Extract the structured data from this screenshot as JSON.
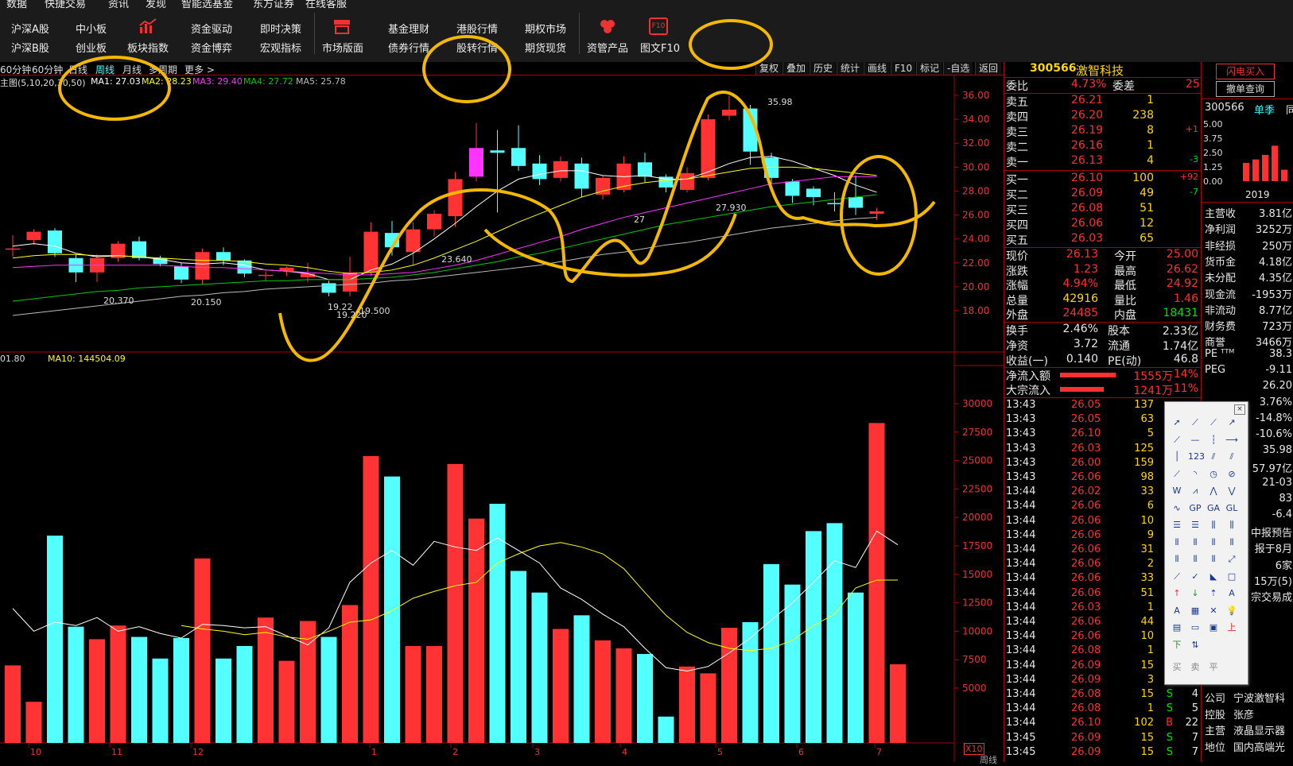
{
  "menu": {
    "top_cut": [
      "数据",
      "快捷交易",
      "资讯",
      "发现",
      "智能选基金",
      "东方证券",
      "在线客服"
    ],
    "row1": [
      "沪深A股",
      "中小板",
      "板块指数",
      "资金驱动",
      "即时决策",
      "市场版面",
      "基金理财",
      "港股行情",
      "期权市场",
      "资管产品",
      "图文F10"
    ],
    "row2": [
      "沪深B股",
      "创业板",
      "资金博弈",
      "宏观指标",
      "债券行情",
      "股转行情",
      "期货现货"
    ],
    "f10_icon_text": "F10"
  },
  "periods": [
    "60分钟",
    "60分钟",
    "日线",
    "周线",
    "月线",
    "多周期",
    "更多 >"
  ],
  "period_active": "周线",
  "chart_tools": [
    "复权",
    "叠加",
    "历史",
    "统计",
    "画线",
    "F10",
    "标记",
    "-自选",
    "返回"
  ],
  "ma_legend": {
    "main": "主图(5,10,20,30,50)",
    "ma1": "MA1: 27.03",
    "ma2": "MA2: 28.23",
    "ma3": "MA3: 29.40",
    "ma4": "MA4: 27.72",
    "ma5": "MA5: 25.78"
  },
  "vol_legend": {
    "vol": "01.80",
    "ma10": "MA10: 144504.09"
  },
  "annotations": {
    "high": "35.98",
    "low1": "19.22",
    "low2": "19.220",
    "low3": "19.500",
    "p1": "20.370",
    "p2": "20.150",
    "p3": "23.640",
    "p4": "27.930",
    "p5": "27",
    "x10": "X10",
    "week": "周线"
  },
  "colors": {
    "up": "#ff3333",
    "down": "#54ffff",
    "ma1": "#ffffff",
    "ma2": "#ffff00",
    "ma3": "#ff33ff",
    "ma4": "#00cc00",
    "ma5": "#bbbbbb",
    "annotation": "#f5b800"
  },
  "chart_data": {
    "type": "candlestick",
    "price_axis": {
      "ticks": [
        "36.00",
        "34.00",
        "32.00",
        "30.00",
        "28.00",
        "26.00",
        "24.00",
        "22.00",
        "20.00",
        "18.00"
      ],
      "ylim": [
        17,
        37.2
      ]
    },
    "volume_axis": {
      "ticks": [
        "30000",
        "27500",
        "25000",
        "22500",
        "20000",
        "17500",
        "15000",
        "12500",
        "10000",
        "7500",
        "5000"
      ],
      "ylim": [
        0,
        31400
      ]
    },
    "x_ticks": [
      "10",
      "11",
      "12",
      "1",
      "2",
      "3",
      "4",
      "5",
      "6",
      "7"
    ],
    "candles": [
      {
        "o": 23.2,
        "c": 23.2,
        "h": 24.3,
        "l": 22.5,
        "up": true
      },
      {
        "o": 24.6,
        "c": 23.9,
        "h": 24.8,
        "l": 23.5,
        "up": true
      },
      {
        "o": 24.7,
        "c": 22.8,
        "h": 24.9,
        "l": 22.5,
        "up": false
      },
      {
        "o": 22.4,
        "c": 21.2,
        "h": 22.7,
        "l": 20.4,
        "up": false
      },
      {
        "o": 21.2,
        "c": 22.4,
        "h": 22.7,
        "l": 20.4,
        "up": true
      },
      {
        "o": 22.4,
        "c": 23.6,
        "h": 23.8,
        "l": 22.1,
        "up": true
      },
      {
        "o": 23.8,
        "c": 22.4,
        "h": 24.2,
        "l": 22.2,
        "up": false
      },
      {
        "o": 22.4,
        "c": 21.9,
        "h": 22.6,
        "l": 21.7,
        "up": false
      },
      {
        "o": 21.7,
        "c": 20.6,
        "h": 22.0,
        "l": 20.3,
        "up": false
      },
      {
        "o": 20.6,
        "c": 22.9,
        "h": 23.2,
        "l": 20.2,
        "up": true
      },
      {
        "o": 22.9,
        "c": 22.2,
        "h": 23.3,
        "l": 21.8,
        "up": false
      },
      {
        "o": 22.2,
        "c": 21.1,
        "h": 22.3,
        "l": 20.8,
        "up": false
      },
      {
        "o": 21.0,
        "c": 20.9,
        "h": 21.3,
        "l": 20.5,
        "up": true
      },
      {
        "o": 21.3,
        "c": 21.6,
        "h": 21.7,
        "l": 20.9,
        "up": true
      },
      {
        "o": 21.1,
        "c": 20.8,
        "h": 22.0,
        "l": 20.4,
        "up": true
      },
      {
        "o": 20.3,
        "c": 19.5,
        "h": 20.5,
        "l": 19.2,
        "up": false
      },
      {
        "o": 19.6,
        "c": 21.2,
        "h": 22.5,
        "l": 19.2,
        "up": true
      },
      {
        "o": 21.2,
        "c": 24.6,
        "h": 25.4,
        "l": 20.9,
        "up": true
      },
      {
        "o": 24.5,
        "c": 23.3,
        "h": 25.5,
        "l": 22.6,
        "up": false
      },
      {
        "o": 22.9,
        "c": 24.8,
        "h": 25.4,
        "l": 21.8,
        "up": true
      },
      {
        "o": 24.8,
        "c": 26.1,
        "h": 26.4,
        "l": 24.2,
        "up": true
      },
      {
        "o": 25.9,
        "c": 29.0,
        "h": 29.6,
        "l": 25.0,
        "up": true
      },
      {
        "o": 29.2,
        "c": 31.6,
        "h": 33.7,
        "l": 28.8,
        "up": true
      },
      {
        "o": 31.4,
        "c": 31.2,
        "h": 33.1,
        "l": 26.2,
        "up": false
      },
      {
        "o": 31.6,
        "c": 30.1,
        "h": 33.5,
        "l": 29.7,
        "up": false
      },
      {
        "o": 30.3,
        "c": 29.0,
        "h": 31.0,
        "l": 28.5,
        "up": false
      },
      {
        "o": 29.1,
        "c": 30.5,
        "h": 30.9,
        "l": 28.8,
        "up": true
      },
      {
        "o": 30.3,
        "c": 28.2,
        "h": 30.8,
        "l": 27.5,
        "up": false
      },
      {
        "o": 29.1,
        "c": 27.7,
        "h": 29.3,
        "l": 27.3,
        "up": true
      },
      {
        "o": 28.1,
        "c": 30.3,
        "h": 30.9,
        "l": 27.9,
        "up": true
      },
      {
        "o": 30.4,
        "c": 29.2,
        "h": 31.2,
        "l": 28.7,
        "up": false
      },
      {
        "o": 29.2,
        "c": 28.3,
        "h": 29.4,
        "l": 27.9,
        "up": false
      },
      {
        "o": 28.1,
        "c": 29.5,
        "h": 30.0,
        "l": 27.9,
        "up": true
      },
      {
        "o": 29.1,
        "c": 34.0,
        "h": 34.4,
        "l": 28.9,
        "up": true
      },
      {
        "o": 34.3,
        "c": 34.8,
        "h": 35.98,
        "l": 33.9,
        "up": true
      },
      {
        "o": 34.9,
        "c": 31.3,
        "h": 35.2,
        "l": 30.2,
        "up": false
      },
      {
        "o": 30.8,
        "c": 29.1,
        "h": 31.2,
        "l": 28.6,
        "up": false
      },
      {
        "o": 28.8,
        "c": 27.6,
        "h": 29.0,
        "l": 27.0,
        "up": false
      },
      {
        "o": 28.2,
        "c": 27.5,
        "h": 28.4,
        "l": 26.8,
        "up": false
      },
      {
        "o": 27.0,
        "c": 26.9,
        "h": 27.9,
        "l": 26.3,
        "up": false
      },
      {
        "o": 27.5,
        "c": 26.6,
        "h": 29.3,
        "l": 26.0,
        "up": false
      },
      {
        "o": 26.3,
        "c": 26.1,
        "h": 26.6,
        "l": 25.6,
        "up": true
      }
    ],
    "ma_series": {
      "ma1": [
        23.4,
        23.6,
        23.4,
        22.8,
        22.5,
        22.6,
        22.5,
        22.3,
        22.0,
        21.9,
        22.0,
        21.8,
        21.4,
        21.3,
        21.1,
        20.6,
        20.6,
        21.4,
        21.9,
        22.8,
        24.0,
        25.3,
        26.7,
        28.0,
        29.0,
        29.4,
        29.7,
        29.7,
        29.3,
        29.2,
        29.3,
        29.0,
        29.0,
        29.6,
        30.3,
        30.8,
        30.9,
        30.5,
        29.9,
        29.3,
        28.5,
        27.9
      ],
      "ma2": [
        22.4,
        22.6,
        22.7,
        22.7,
        22.6,
        22.6,
        22.5,
        22.4,
        22.3,
        22.2,
        22.2,
        22.1,
        21.9,
        21.8,
        21.6,
        21.3,
        21.1,
        21.2,
        21.4,
        21.8,
        22.4,
        23.1,
        23.8,
        24.6,
        25.4,
        26.1,
        26.8,
        27.5,
        28.0,
        28.4,
        28.7,
        28.9,
        29.0,
        29.3,
        29.6,
        29.9,
        30.0,
        30.0,
        29.9,
        29.7,
        29.5,
        29.3
      ],
      "ma3": [
        21.6,
        21.7,
        21.8,
        21.8,
        21.8,
        21.8,
        21.8,
        21.8,
        21.7,
        21.6,
        21.6,
        21.5,
        21.4,
        21.3,
        21.2,
        21.1,
        21.0,
        21.0,
        21.1,
        21.2,
        21.5,
        21.8,
        22.2,
        22.7,
        23.2,
        23.7,
        24.2,
        24.8,
        25.3,
        25.8,
        26.2,
        26.6,
        27.0,
        27.4,
        27.8,
        28.2,
        28.6,
        28.8,
        29.0,
        29.2,
        29.2,
        29.2
      ],
      "ma4": [
        18.8,
        19.0,
        19.2,
        19.4,
        19.6,
        19.7,
        19.9,
        20.0,
        20.1,
        20.2,
        20.3,
        20.4,
        20.5,
        20.5,
        20.6,
        20.6,
        20.6,
        20.7,
        20.8,
        21.0,
        21.2,
        21.5,
        21.8,
        22.1,
        22.5,
        22.8,
        23.2,
        23.6,
        24.0,
        24.4,
        24.8,
        25.2,
        25.5,
        25.8,
        26.1,
        26.4,
        26.7,
        26.9,
        27.1,
        27.3,
        27.5,
        27.7
      ],
      "ma5": [
        17.6,
        17.8,
        18.0,
        18.2,
        18.4,
        18.6,
        18.8,
        19.0,
        19.2,
        19.3,
        19.5,
        19.6,
        19.8,
        19.9,
        20.0,
        20.1,
        20.2,
        20.3,
        20.5,
        20.6,
        20.8,
        21.0,
        21.2,
        21.4,
        21.6,
        21.8,
        22.1,
        22.4,
        22.7,
        22.9,
        23.2,
        23.5,
        23.7,
        24.0,
        24.3,
        24.6,
        24.9,
        25.1,
        25.3,
        25.5,
        25.7,
        25.8
      ]
    },
    "volume": [
      7000,
      3800,
      18400,
      10400,
      9300,
      10500,
      9500,
      7600,
      9400,
      16400,
      7600,
      8700,
      11200,
      7400,
      10900,
      9500,
      12300,
      25400,
      23600,
      8700,
      8700,
      24700,
      19900,
      21200,
      15300,
      13400,
      10200,
      11400,
      9200,
      8500,
      8000,
      2500,
      6900,
      6300,
      10300,
      10800,
      15900,
      14100,
      18800,
      19500,
      13400,
      28300,
      7100
    ],
    "vol_ma5": [
      12000,
      10000,
      10800,
      10500,
      11200,
      10000,
      10400,
      9800,
      9400,
      10600,
      10500,
      10300,
      10400,
      9600,
      8800,
      10300,
      14300,
      16000,
      17100,
      15800,
      17900,
      17400,
      17100,
      18200,
      17100,
      16000,
      13800,
      12800,
      11500,
      10400,
      8500,
      6800,
      6500,
      6900,
      8100,
      9400,
      11000,
      12500,
      14300,
      16200,
      15600,
      18800,
      17600
    ],
    "vol_ma10": [
      null,
      null,
      null,
      null,
      null,
      null,
      null,
      null,
      10500,
      10200,
      10000,
      9700,
      9900,
      9500,
      9300,
      10000,
      10800,
      11000,
      11800,
      12900,
      13500,
      14000,
      14300,
      16000,
      16800,
      17500,
      17800,
      17400,
      16800,
      15500,
      13400,
      11400,
      9900,
      9000,
      8500,
      8300,
      8500,
      9200,
      10500,
      11500,
      13800,
      14500,
      14500
    ]
  },
  "quote": {
    "code": "300566",
    "name": "激智科技",
    "weibi_label": "委比",
    "weibi": "4.73%",
    "weicha_label": "委差",
    "weicha": "25",
    "asks": [
      {
        "label": "卖五",
        "price": "26.21",
        "vol": "1",
        "chg": ""
      },
      {
        "label": "卖四",
        "price": "26.20",
        "vol": "238",
        "chg": ""
      },
      {
        "label": "卖三",
        "price": "26.19",
        "vol": "8",
        "chg": "+1"
      },
      {
        "label": "卖二",
        "price": "26.16",
        "vol": "1",
        "chg": ""
      },
      {
        "label": "卖一",
        "price": "26.13",
        "vol": "4",
        "chg": "-3"
      }
    ],
    "bids": [
      {
        "label": "买一",
        "price": "26.10",
        "vol": "100",
        "chg": "+92"
      },
      {
        "label": "买二",
        "price": "26.09",
        "vol": "49",
        "chg": "-7"
      },
      {
        "label": "买三",
        "price": "26.08",
        "vol": "51",
        "chg": ""
      },
      {
        "label": "买四",
        "price": "26.06",
        "vol": "12",
        "chg": ""
      },
      {
        "label": "买五",
        "price": "26.03",
        "vol": "65",
        "chg": ""
      }
    ],
    "stats": [
      {
        "l1": "现价",
        "v1": "26.13",
        "c1": "red",
        "l2": "今开",
        "v2": "25.00",
        "c2": "red"
      },
      {
        "l1": "涨跌",
        "v1": "1.23",
        "c1": "red",
        "l2": "最高",
        "v2": "26.62",
        "c2": "red"
      },
      {
        "l1": "涨幅",
        "v1": "4.94%",
        "c1": "red",
        "l2": "最低",
        "v2": "24.92",
        "c2": "red"
      },
      {
        "l1": "总量",
        "v1": "42916",
        "c1": "yellow",
        "l2": "量比",
        "v2": "1.46",
        "c2": "red"
      },
      {
        "l1": "外盘",
        "v1": "24485",
        "c1": "red",
        "l2": "内盘",
        "v2": "18431",
        "c2": "green"
      }
    ],
    "stats2": [
      {
        "l1": "换手",
        "v1": "2.46%",
        "l2": "股本",
        "v2": "2.33亿"
      },
      {
        "l1": "净资",
        "v1": "3.72",
        "l2": "流通",
        "v2": "1.74亿"
      },
      {
        "l1": "收益(一)",
        "v1": "0.140",
        "l2": "PE(动)",
        "v2": "46.8"
      }
    ],
    "flows": [
      {
        "label": "净流入额",
        "value": "1555万",
        "pct": "14%"
      },
      {
        "label": "大宗流入",
        "value": "1241万",
        "pct": "11%"
      }
    ],
    "ticks": [
      [
        "13:43",
        "26.05",
        "137",
        "",
        ""
      ],
      [
        "13:43",
        "26.05",
        "63",
        "",
        ""
      ],
      [
        "13:43",
        "26.10",
        "5",
        "",
        ""
      ],
      [
        "13:43",
        "26.03",
        "125",
        "",
        ""
      ],
      [
        "13:43",
        "26.00",
        "159",
        "",
        ""
      ],
      [
        "13:43",
        "26.06",
        "98",
        "",
        ""
      ],
      [
        "13:44",
        "26.02",
        "33",
        "",
        ""
      ],
      [
        "13:44",
        "26.06",
        "6",
        "",
        ""
      ],
      [
        "13:44",
        "26.06",
        "10",
        "",
        ""
      ],
      [
        "13:44",
        "26.06",
        "9",
        "",
        ""
      ],
      [
        "13:44",
        "26.06",
        "31",
        "",
        ""
      ],
      [
        "13:44",
        "26.06",
        "2",
        "",
        ""
      ],
      [
        "13:44",
        "26.06",
        "33",
        "",
        ""
      ],
      [
        "13:44",
        "26.06",
        "51",
        "",
        ""
      ],
      [
        "13:44",
        "26.03",
        "1",
        "",
        ""
      ],
      [
        "13:44",
        "26.06",
        "44",
        "",
        ""
      ],
      [
        "13:44",
        "26.06",
        "10",
        "",
        ""
      ],
      [
        "13:44",
        "26.08",
        "1",
        "",
        ""
      ],
      [
        "13:44",
        "26.09",
        "15",
        "",
        ""
      ],
      [
        "13:44",
        "26.09",
        "3",
        "B",
        ""
      ],
      [
        "13:44",
        "26.08",
        "15",
        "S",
        "4"
      ],
      [
        "13:44",
        "26.08",
        "1",
        "S",
        "5"
      ],
      [
        "13:44",
        "26.10",
        "102",
        "B",
        "22"
      ],
      [
        "13:45",
        "26.09",
        "15",
        "S",
        "7"
      ],
      [
        "13:45",
        "26.09",
        "15",
        "S",
        "7"
      ]
    ]
  },
  "right": {
    "flash_buy": "闪电买入",
    "cancel_query": "撤单查询",
    "code": "300566",
    "season": "单季",
    "same": "同",
    "bar_ticks": [
      "5.00",
      "3.75",
      "2.50",
      "1.25",
      "0.00"
    ],
    "bar_year": "2019",
    "bar_values": [
      1.6,
      1.9,
      2.3,
      3.1,
      1.0
    ],
    "fin": [
      {
        "l": "主营收",
        "v": "3.81亿"
      },
      {
        "l": "净利润",
        "v": "3252万"
      },
      {
        "l": "非经损",
        "v": "250万"
      },
      {
        "l": "货币金",
        "v": "4.18亿"
      },
      {
        "l": "未分配",
        "v": "4.35亿"
      },
      {
        "l": "现金流",
        "v": "-1953万"
      },
      {
        "l": "非流动",
        "v": "8.77亿"
      },
      {
        "l": "财务费",
        "v": "723万"
      },
      {
        "l": "商誉",
        "v": "3466万"
      }
    ],
    "fin2": [
      {
        "l": "PE ᵀᵀᴹ",
        "v": "38.3"
      },
      {
        "l": "PEG",
        "v": "-9.11"
      },
      {
        "l": "",
        "v": "26.20"
      },
      {
        "l": "",
        "v": "3.76%"
      },
      {
        "l": "",
        "v": "-14.8%"
      },
      {
        "l": "",
        "v": "-10.6%"
      },
      {
        "l": "",
        "v": "35.98"
      },
      {
        "l": "",
        "v": "57.97亿"
      },
      {
        "l": "",
        "v": "21-03"
      },
      {
        "l": "",
        "v": "83"
      },
      {
        "l": "",
        "v": "-6.4"
      },
      {
        "l": "",
        "v": "中报预告"
      },
      {
        "l": "",
        "v": "报于8月"
      },
      {
        "l": "",
        "v": "6家"
      },
      {
        "l": "",
        "v": "15万(5)"
      },
      {
        "l": "",
        "v": "宗交易成"
      }
    ],
    "company": [
      {
        "l": "公司",
        "v": "宁波激智科"
      },
      {
        "l": "控股",
        "v": "张彦"
      },
      {
        "l": "主营",
        "v": "液晶显示器"
      },
      {
        "l": "地位",
        "v": "国内高端光"
      }
    ]
  },
  "draw_toolbar": {
    "icons": [
      "cursor",
      "line",
      "ray",
      "arrow-line",
      "segment",
      "h-line",
      "v-dotted",
      "h-ray",
      "v-line",
      "123",
      "parallel",
      "parallel2",
      "ruler",
      "arc",
      "circle",
      "circle-x",
      "wave",
      "zigzag",
      "wave2",
      "zigzag2",
      "wave3",
      "gp",
      "ga",
      "gl",
      "fib1",
      "fib2",
      "fib3",
      "fib4",
      "bars",
      "bars2",
      "bars3",
      "bars4",
      "bars5",
      "bars6",
      "bars7",
      "diag",
      "fan",
      "check",
      "flag",
      "rect",
      "up-arrow",
      "down-arrow",
      "tri-arrow",
      "A",
      "A2",
      "square",
      "x",
      "bulb",
      "list",
      "label",
      "box",
      "up-mark",
      "T-mark",
      "up-down"
    ],
    "up": "上",
    "down": "下",
    "buy": "买",
    "sell": "卖",
    "flat": "平"
  }
}
